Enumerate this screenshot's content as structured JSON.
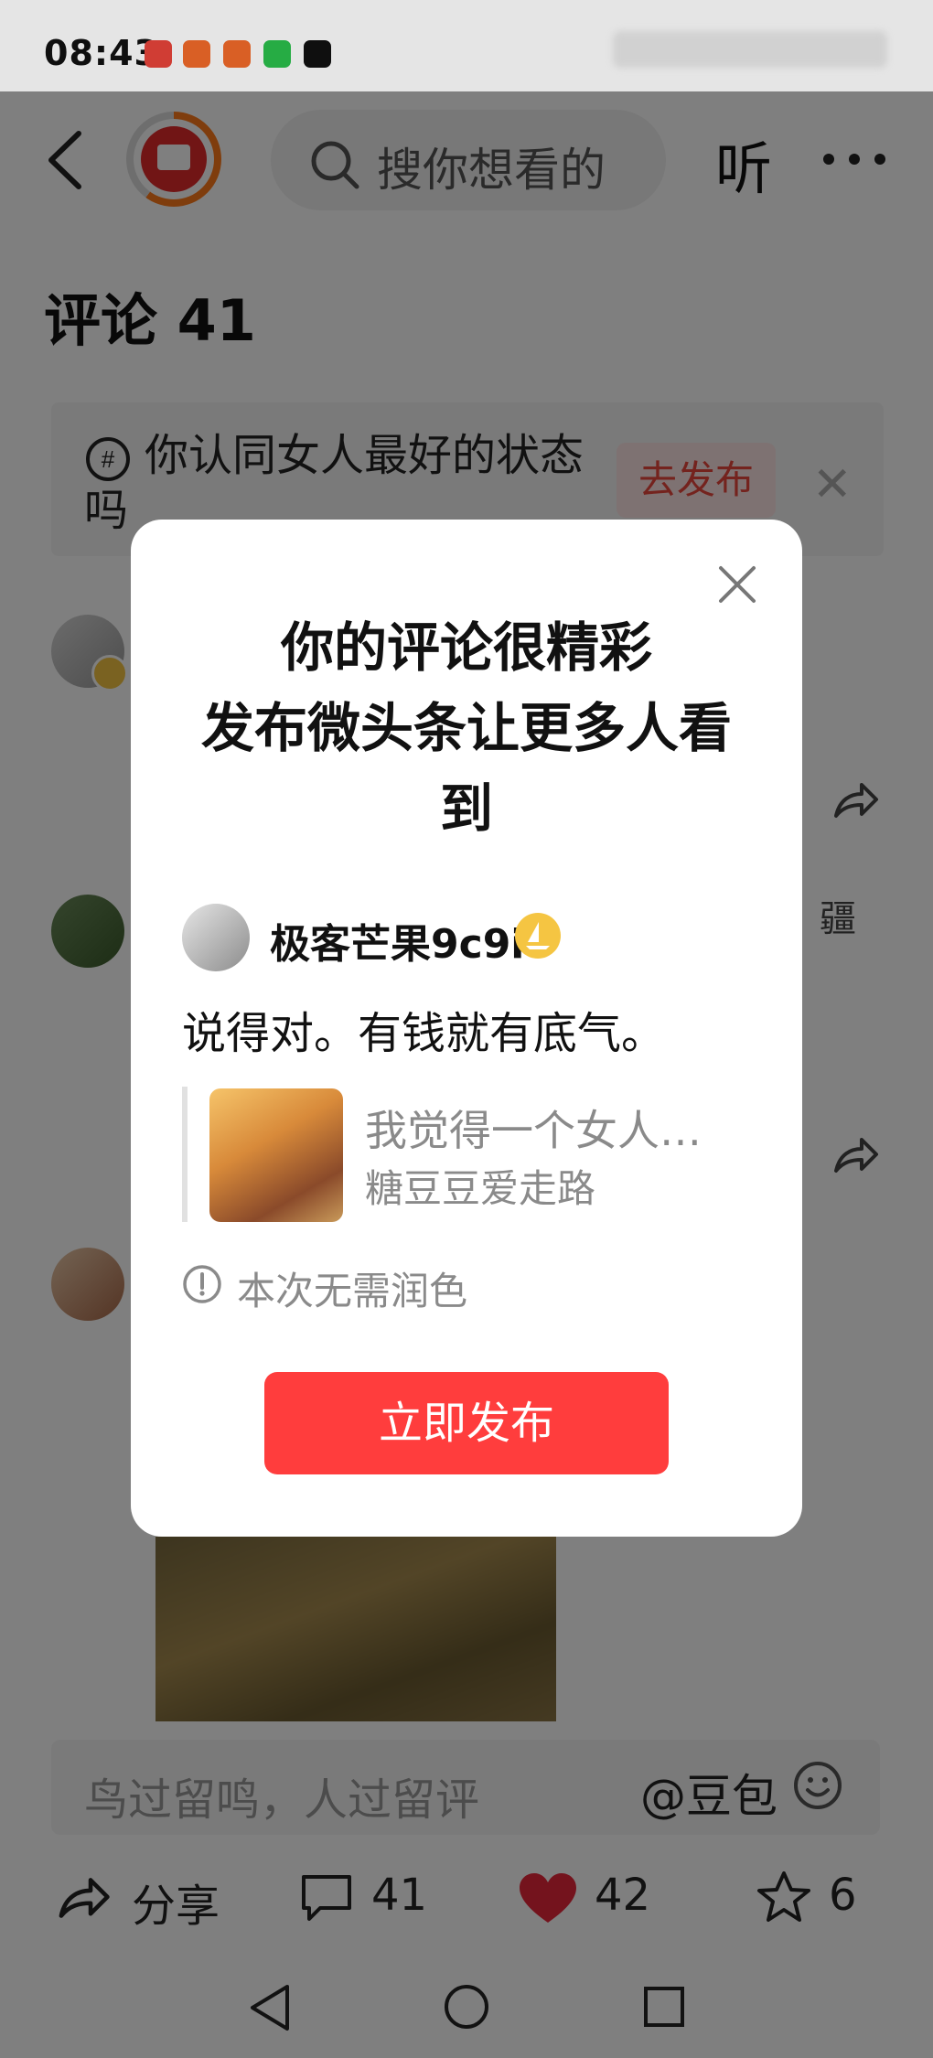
{
  "status_bar": {
    "time": "08:43",
    "notification_icons": [
      "red-app-icon",
      "orange-app-icon",
      "orange-app-icon",
      "wechat-icon",
      "capcut-icon"
    ]
  },
  "header": {
    "search_placeholder": "搜你想看的",
    "listen_label": "听"
  },
  "comments": {
    "title": "评论 41"
  },
  "topic_banner": {
    "text": "你认同女人最好的状态吗",
    "publish_label": "去发布"
  },
  "background_partial": {
    "right_text": "疆"
  },
  "comment_input": {
    "placeholder": "鸟过留鸣，人过留评",
    "mention": "@豆包"
  },
  "actions": {
    "share_label": "分享",
    "comment_count": "41",
    "like_count": "42",
    "favorite_count": "6"
  },
  "modal": {
    "title_line1": "你的评论很精彩",
    "title_line2": "发布微头条让更多人看",
    "title_line3": "到",
    "username": "极客芒果9c9i",
    "comment_text": "说得对。有钱就有底气。",
    "quote_text": "我觉得一个女人…",
    "quote_author": "糖豆豆爱走路",
    "notice": "本次无需润色",
    "publish_button": "立即发布"
  },
  "colors": {
    "accent_red": "#ff3d3d",
    "dim_overlay": "rgba(0,0,0,0.5)"
  }
}
